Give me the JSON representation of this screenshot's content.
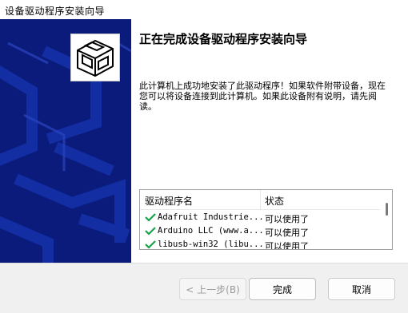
{
  "window": {
    "title": "设备驱动程序安装向导"
  },
  "header": {
    "title": "正在完成设备驱动程序安装向导"
  },
  "description": "此计算机上成功地安装了此驱动程序！如果软件附带设备，现在您可以将设备连接到此计算机。如果此设备附有说明，请先阅读。",
  "table": {
    "columns": [
      "驱动程序名",
      "状态"
    ],
    "rows": [
      {
        "name": "Adafruit Industrie...",
        "status": "可以使用了"
      },
      {
        "name": "Arduino LLC (www.a...",
        "status": "可以使用了"
      },
      {
        "name": "libusb-win32 (libu...",
        "status": "可以使用了"
      }
    ]
  },
  "buttons": {
    "back": "< 上一步(B)",
    "finish": "完成",
    "cancel": "取消"
  },
  "colors": {
    "banner": "#0a1b7b",
    "check": "#16a34a"
  }
}
